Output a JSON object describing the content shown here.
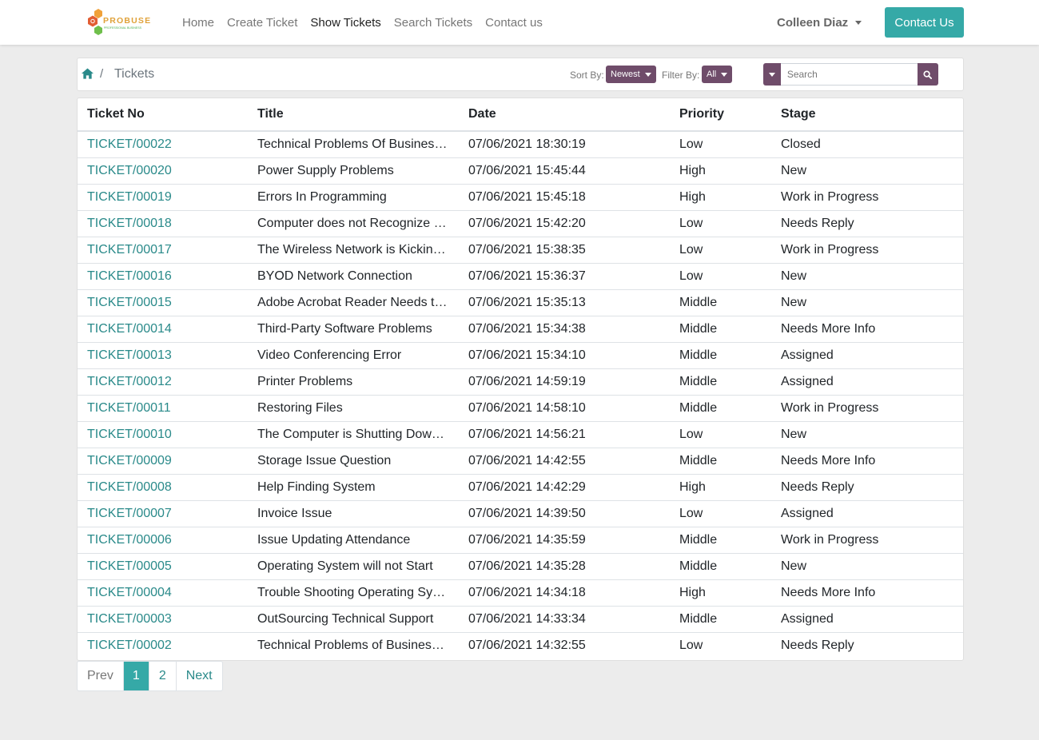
{
  "brand": {
    "logo_text": "PROBUSE",
    "logo_tagline": "PROFESSIONAL BUSINESS",
    "colors": {
      "accent": "#35a9a7",
      "secondary": "#6f4c6a",
      "link": "#2a8a8a"
    }
  },
  "nav": {
    "items": [
      {
        "label": "Home",
        "active": false
      },
      {
        "label": "Create Ticket",
        "active": false
      },
      {
        "label": "Show Tickets",
        "active": true
      },
      {
        "label": "Search Tickets",
        "active": false
      },
      {
        "label": "Contact us",
        "active": false
      }
    ],
    "user_name": "Colleen Diaz",
    "contact_button": "Contact Us"
  },
  "breadcrumb": {
    "separator": "/",
    "current": "Tickets"
  },
  "toolbar": {
    "sort_label": "Sort By:",
    "sort_value": "Newest",
    "filter_label": "Filter By:",
    "filter_value": "All",
    "search_placeholder": "Search"
  },
  "table": {
    "columns": [
      "Ticket No",
      "Title",
      "Date",
      "Priority",
      "Stage"
    ],
    "rows": [
      [
        "TICKET/00022",
        "Technical Problems Of Business Plans",
        "07/06/2021 18:30:19",
        "Low",
        "Closed"
      ],
      [
        "TICKET/00020",
        "Power Supply Problems",
        "07/06/2021 15:45:44",
        "High",
        "New"
      ],
      [
        "TICKET/00019",
        "Errors In Programming",
        "07/06/2021 15:45:18",
        "High",
        "Work in Progress"
      ],
      [
        "TICKET/00018",
        "Computer does not Recognize the Device",
        "07/06/2021 15:42:20",
        "Low",
        "Needs Reply"
      ],
      [
        "TICKET/00017",
        "The Wireless Network is Kicking Users Off",
        "07/06/2021 15:38:35",
        "Low",
        "Work in Progress"
      ],
      [
        "TICKET/00016",
        "BYOD Network Connection",
        "07/06/2021 15:36:37",
        "Low",
        "New"
      ],
      [
        "TICKET/00015",
        "Adobe Acrobat Reader Needs to be Updated",
        "07/06/2021 15:35:13",
        "Middle",
        "New"
      ],
      [
        "TICKET/00014",
        "Third-Party Software Problems",
        "07/06/2021 15:34:38",
        "Middle",
        "Needs More Info"
      ],
      [
        "TICKET/00013",
        "Video Conferencing Error",
        "07/06/2021 15:34:10",
        "Middle",
        "Assigned"
      ],
      [
        "TICKET/00012",
        "Printer Problems",
        "07/06/2021 14:59:19",
        "Middle",
        "Assigned"
      ],
      [
        "TICKET/00011",
        "Restoring Files",
        "07/06/2021 14:58:10",
        "Middle",
        "Work in Progress"
      ],
      [
        "TICKET/00010",
        "The Computer is Shutting Down Randomly",
        "07/06/2021 14:56:21",
        "Low",
        "New"
      ],
      [
        "TICKET/00009",
        "Storage Issue Question",
        "07/06/2021 14:42:55",
        "Middle",
        "Needs More Info"
      ],
      [
        "TICKET/00008",
        "Help Finding System",
        "07/06/2021 14:42:29",
        "High",
        "Needs Reply"
      ],
      [
        "TICKET/00007",
        "Invoice Issue",
        "07/06/2021 14:39:50",
        "Low",
        "Assigned"
      ],
      [
        "TICKET/00006",
        "Issue Updating Attendance",
        "07/06/2021 14:35:59",
        "Middle",
        "Work in Progress"
      ],
      [
        "TICKET/00005",
        "Operating System will not Start",
        "07/06/2021 14:35:28",
        "Middle",
        "New"
      ],
      [
        "TICKET/00004",
        "Trouble Shooting Operating System Errors",
        "07/06/2021 14:34:18",
        "High",
        "Needs More Info"
      ],
      [
        "TICKET/00003",
        "OutSourcing Technical Support",
        "07/06/2021 14:33:34",
        "Middle",
        "Assigned"
      ],
      [
        "TICKET/00002",
        "Technical Problems of Business Software",
        "07/06/2021 14:32:55",
        "Low",
        "Needs Reply"
      ]
    ]
  },
  "pagination": {
    "prev": "Prev",
    "pages": [
      "1",
      "2"
    ],
    "current": "1",
    "next": "Next"
  }
}
